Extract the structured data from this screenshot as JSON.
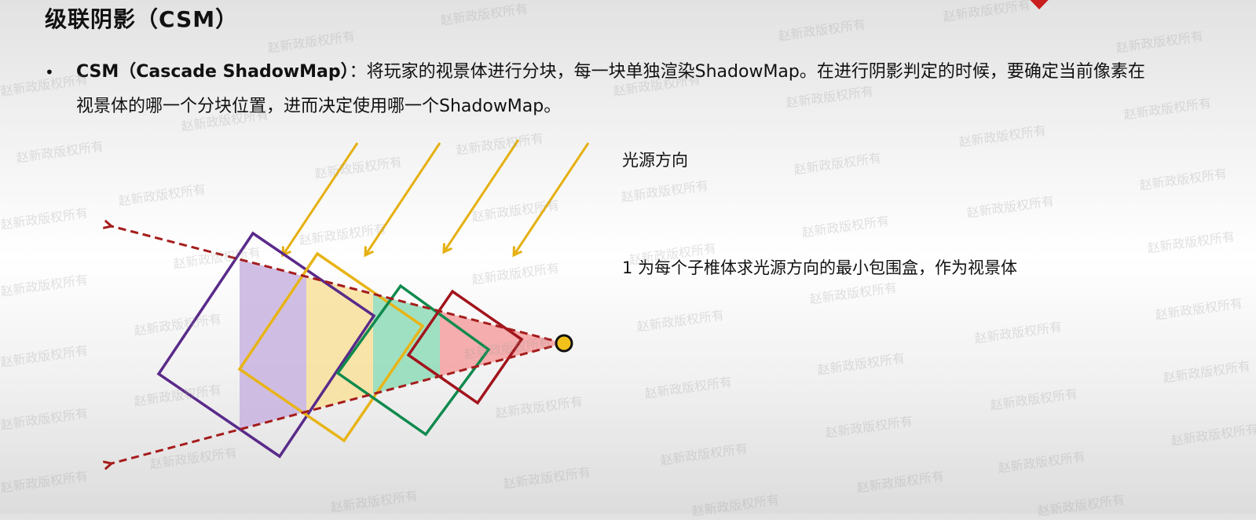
{
  "title": "级联阴影（CSM）",
  "bullet": {
    "term": "CSM（Cascade ShadowMap）",
    "separator": "：",
    "text": "将玩家的视景体进行分块，每一块单独渲染ShadowMap。在进行阴影判定的时候，要确定当前像素在视景体的哪一个分块位置，进而决定使用哪一个ShadowMap。"
  },
  "labels": {
    "light_direction": "光源方向",
    "step_one": "1 为每个子椎体求光源方向的最小包围盒，作为视景体"
  },
  "watermark_text": "赵新政版权所有",
  "colors": {
    "frustum_line": "#a51c1c",
    "light_ray": "#e6b012",
    "camera_fill": "#f2c21b",
    "cascade_1": "#5a2a8a",
    "cascade_2": "#e8b417",
    "cascade_3": "#0f8a4e",
    "cascade_4": "#a2141c",
    "cascade_1_fill": "#c9b3e0",
    "cascade_2_fill": "#f8e09b",
    "cascade_3_fill": "#8fdcb8",
    "cascade_4_fill": "#f5a0a0"
  }
}
